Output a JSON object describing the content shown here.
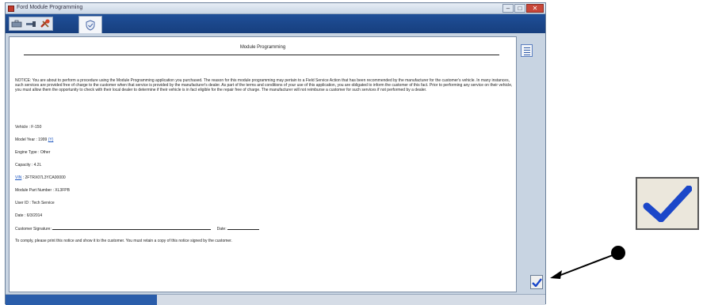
{
  "window": {
    "title": "Ford Module Programming",
    "minimize_glyph": "–",
    "maximize_glyph": "□",
    "close_glyph": "✕"
  },
  "toolbar": {
    "buttons": [
      {
        "name": "toolbox-icon"
      },
      {
        "name": "connect-icon"
      },
      {
        "name": "tools-icon"
      }
    ],
    "active_tab_icon": "vehicle-shield-icon"
  },
  "document": {
    "title": "Module Programming",
    "notice": "NOTICE: You are about to perform a procedure using the Module Programming application you purchased. The reason for this module programming may pertain to a Field Service Action that has been recommended by the manufacturer for the customer's vehicle. In many instances, such services are provided free of charge to the customer when that service is provided by the manufacturer's dealer. As part of the terms and conditions of your use of this application, you are obligated to inform the customer of this fact. Prior to performing any service on their vehicle, you must allow them the opportunity to check with their local dealer to determine if their vehicle is in fact eligible for the repair free of charge. The manufacturer will not reimburse a customer for such services if not performed by a dealer.",
    "vehicle": "Vehicle : F-150",
    "model_year_label": "Model Year : 1999",
    "model_year_link": "(Y)",
    "engine_type": "Engine Type : Other",
    "capacity": "Capacity : 4.2L",
    "vin_link": "VIN",
    "vin_value": ": 2FTRX07L3YCA00000",
    "module_part_number": "Module Part Number : XL3FPB",
    "user_id": "User ID : Tech Service",
    "date": "Date : 6/3/2014",
    "signature_label": "Customer Signature:",
    "signature_date_label": "Date:",
    "instruction": "To comply, please print this notice and show it to the customer. You must retain a copy of this notice signed by the customer."
  },
  "sidebar": {
    "document_button_icon": "document-list-icon",
    "confirm_button_icon": "checkmark-icon"
  },
  "status": {
    "progress": 0.28
  },
  "colors": {
    "toolbar": "#1f4f98",
    "check": "#1b47c9",
    "link": "#1a55c0"
  }
}
